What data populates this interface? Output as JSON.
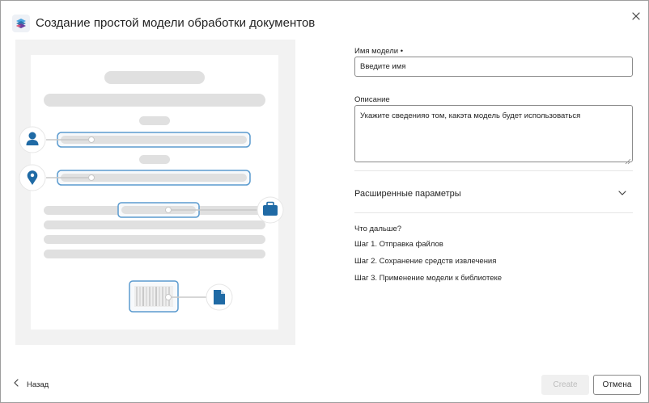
{
  "dialog": {
    "title": "Создание простой модели обработки документов",
    "app_icon": "layers-icon",
    "close_icon": "close-icon"
  },
  "illustration": {
    "icons": [
      "person-icon",
      "location-pin-icon",
      "briefcase-icon",
      "document-icon",
      "barcode-icon"
    ],
    "accent_color": "#1f6aa5"
  },
  "form": {
    "model_name": {
      "label": "Имя модели •",
      "value": "Введите имя"
    },
    "description": {
      "label": "Описание",
      "value": "Укажите сведенияо том, какэта модель будет использоваться"
    },
    "advanced": {
      "label": "Расширенные параметры",
      "icon": "chevron-down-icon"
    }
  },
  "next_steps": {
    "heading": "Что дальше?",
    "steps": [
      "Шаг 1. Отправка файлов",
      "Шаг 2. Сохранение средств извлечения",
      "Шаг 3. Применение модели к библиотеке"
    ]
  },
  "footer": {
    "back_label": "Назад",
    "back_icon": "chevron-left-icon",
    "create_label": "Create",
    "cancel_label": "Отмена"
  }
}
